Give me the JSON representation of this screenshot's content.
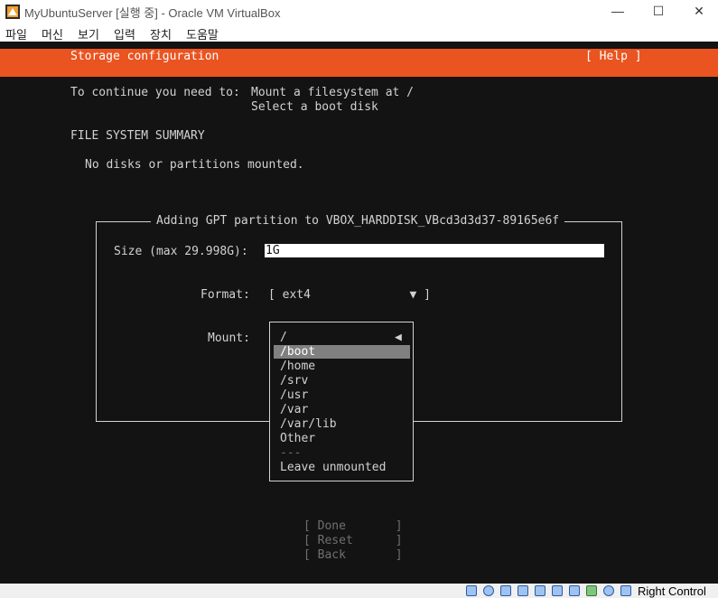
{
  "window": {
    "title": "MyUbuntuServer [실행 중] - Oracle VM VirtualBox",
    "minimize": "—",
    "maximize": "☐",
    "close": "✕"
  },
  "menu": [
    "파일",
    "머신",
    "보기",
    "입력",
    "장치",
    "도움말"
  ],
  "installer": {
    "header_title": "Storage configuration",
    "help_label": "[ Help ]",
    "instruction_prefix": "To continue you need to:",
    "instruction_1": "Mount a filesystem at /",
    "instruction_2": "Select a boot disk",
    "fs_summary_heading": "FILE SYSTEM SUMMARY",
    "no_disks_text": "No disks or partitions mounted.",
    "dialog": {
      "title": "Adding GPT partition to VBOX_HARDDISK_VBcd3d3d37-89165e6f",
      "size_label": "Size (max 29.998G):",
      "size_value": "1G",
      "format_label": "Format:",
      "format_value": "[ ext4              ▼ ]",
      "mount_label": "Mount:",
      "mount_options": [
        "/",
        "/boot",
        "/home",
        "/srv",
        "/usr",
        "/var",
        "/var/lib",
        "Other",
        "---",
        "Leave unmounted"
      ],
      "mount_selected": "/boot",
      "mount_arrow": "◀"
    },
    "buttons": {
      "done": "[ Done       ]",
      "reset": "[ Reset      ]",
      "back": "[ Back       ]"
    }
  },
  "statusbar": {
    "host_key": "Right Control",
    "icons": [
      "hdd-icon",
      "optical-icon",
      "audio-icon",
      "network-icon",
      "usb-icon",
      "shared-folder-icon",
      "display-icon",
      "recording-icon",
      "cpu-icon",
      "mouse-icon",
      "arrow-down-icon"
    ]
  },
  "colors": {
    "accent": "#e95420",
    "console_bg": "#131313",
    "console_fg": "#d2d2d2",
    "selection": "#808080"
  }
}
